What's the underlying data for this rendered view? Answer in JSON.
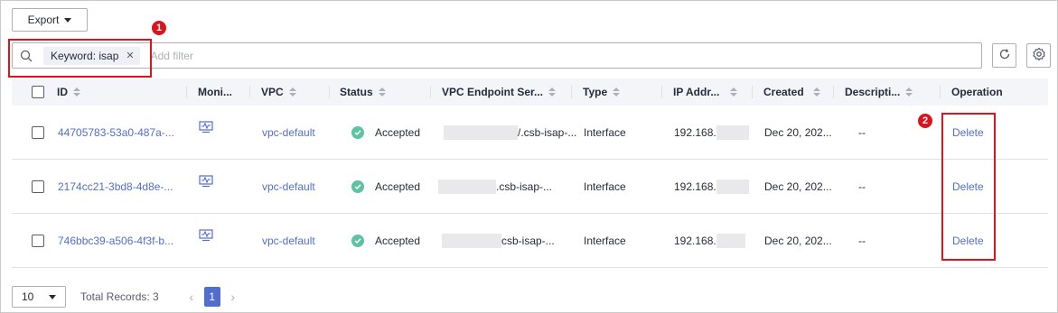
{
  "toolbar": {
    "export_label": "Export"
  },
  "search": {
    "tag_label": "Keyword: isap",
    "placeholder": "Add filter"
  },
  "annotations": [
    "1",
    "2"
  ],
  "table": {
    "columns": [
      "ID",
      "Moni...",
      "VPC",
      "Status",
      "VPC Endpoint Ser...",
      "Type",
      "IP Addr...",
      "Created",
      "Descripti...",
      "Operation"
    ],
    "rows": [
      {
        "id": "44705783-53a0-487a-...",
        "vpc": "vpc-default",
        "status": "Accepted",
        "endpoint": "/.csb-isap-...",
        "type": "Interface",
        "ip": "192.168.",
        "created": "Dec 20, 202...",
        "description": "--",
        "operation": "Delete"
      },
      {
        "id": "2174cc21-3bd8-4d8e-...",
        "vpc": "vpc-default",
        "status": "Accepted",
        "endpoint": ".csb-isap-...",
        "type": "Interface",
        "ip": "192.168.",
        "created": "Dec 20, 202...",
        "description": "--",
        "operation": "Delete"
      },
      {
        "id": "746bbc39-a506-4f3f-b...",
        "vpc": "vpc-default",
        "status": "Accepted",
        "endpoint": "csb-isap-...",
        "type": "Interface",
        "ip": "192.168.",
        "created": "Dec 20, 202...",
        "description": "--",
        "operation": "Delete"
      }
    ]
  },
  "pagination": {
    "page_size": "10",
    "total": "Total Records: 3",
    "current_page": "1"
  },
  "colors": {
    "accent": "#526ecc",
    "success": "#5ec3a0",
    "annotation": "#d9141c"
  },
  "icons": [
    "search-icon",
    "close-icon",
    "refresh-icon",
    "gear-icon",
    "monitor-icon",
    "check-circle-icon",
    "chevron-left-icon",
    "chevron-right-icon"
  ]
}
